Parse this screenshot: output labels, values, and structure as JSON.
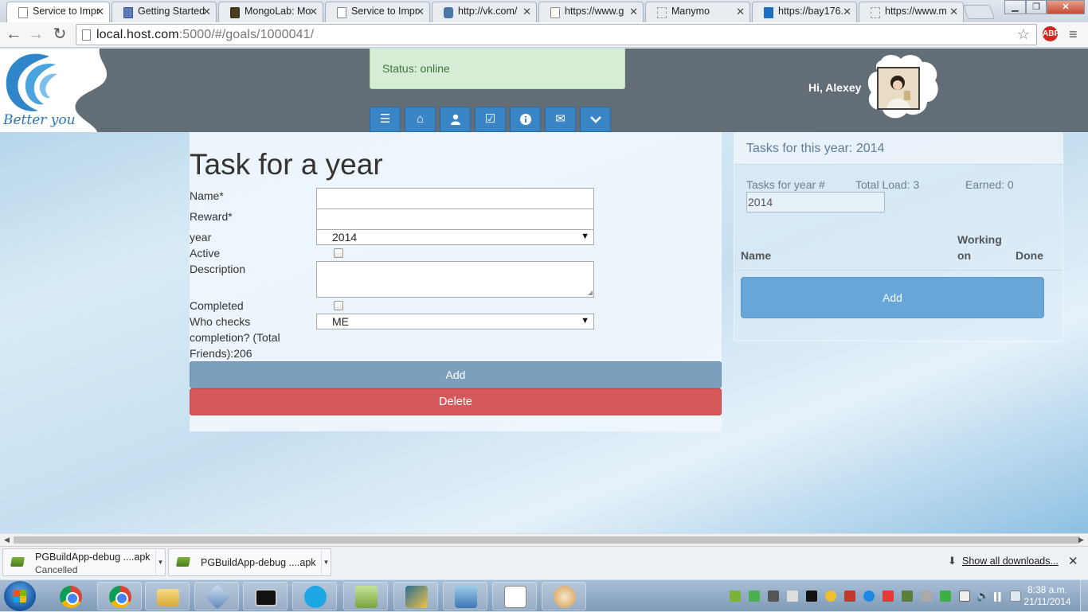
{
  "browser": {
    "tabs": [
      {
        "label": "Service to Impr",
        "icon": "page-icon",
        "active": true
      },
      {
        "label": "Getting Started",
        "icon": "hi-icon"
      },
      {
        "label": "MongoLab: Mo",
        "icon": "mongolab-icon"
      },
      {
        "label": "Service to Impr",
        "icon": "page-icon"
      },
      {
        "label": "http://vk.com/",
        "icon": "vk-icon"
      },
      {
        "label": "https://www.g",
        "icon": "page-icon"
      },
      {
        "label": "Manymo",
        "icon": "loading-icon"
      },
      {
        "label": "https://bay176.",
        "icon": "outlook-icon"
      },
      {
        "label": "https://www.m",
        "icon": "loading-icon"
      }
    ],
    "url_host": "local.host.com",
    "url_rest": ":5000/#/goals/1000041/"
  },
  "app": {
    "logo_text": "Better you",
    "status": "Status: online",
    "nav_icons": [
      "list-icon",
      "home-icon",
      "user-icon",
      "check-icon",
      "info-icon",
      "mail-icon",
      "chevron-down-icon"
    ],
    "greeting": "Hi, Alexey"
  },
  "form": {
    "title": "Task for a year",
    "name_label": "Name*",
    "name_value": "",
    "reward_label": "Reward*",
    "reward_value": "",
    "year_label": "year",
    "year_value": "2014",
    "active_label": "Active",
    "active_checked": false,
    "description_label": "Description",
    "description_value": "",
    "completed_label": "Completed",
    "completed_checked": false,
    "checker_label_1": "Who checks",
    "checker_label_2": "completion? (Total",
    "checker_label_3": "Friends):206",
    "checker_value": "ME",
    "add_label": "Add",
    "delete_label": "Delete"
  },
  "side": {
    "heading": "Tasks for this year: 2014",
    "year_label": "Tasks for year #",
    "total_load": "Total Load: 3",
    "earned": "Earned: 0",
    "year_value": "2014",
    "col_name": "Name",
    "col_working_1": "Working",
    "col_working_2": "on",
    "col_done": "Done",
    "add_label": "Add"
  },
  "downloads": {
    "items": [
      {
        "name": "PGBuildApp-debug ....apk",
        "status": "Cancelled"
      },
      {
        "name": "PGBuildApp-debug ....apk",
        "status": ""
      }
    ],
    "show_all": "Show all downloads..."
  },
  "taskbar": {
    "pinned": [
      "chrome-icon",
      "chrome-icon",
      "explorer-icon",
      "virtualbox-icon",
      "cmd-icon",
      "skype-icon",
      "notepad-icon",
      "app-icon",
      "remote-desktop-icon",
      "list-app-icon",
      "paint-icon"
    ],
    "clock_time": "8:38 a.m.",
    "clock_date": "21/11/2014"
  }
}
